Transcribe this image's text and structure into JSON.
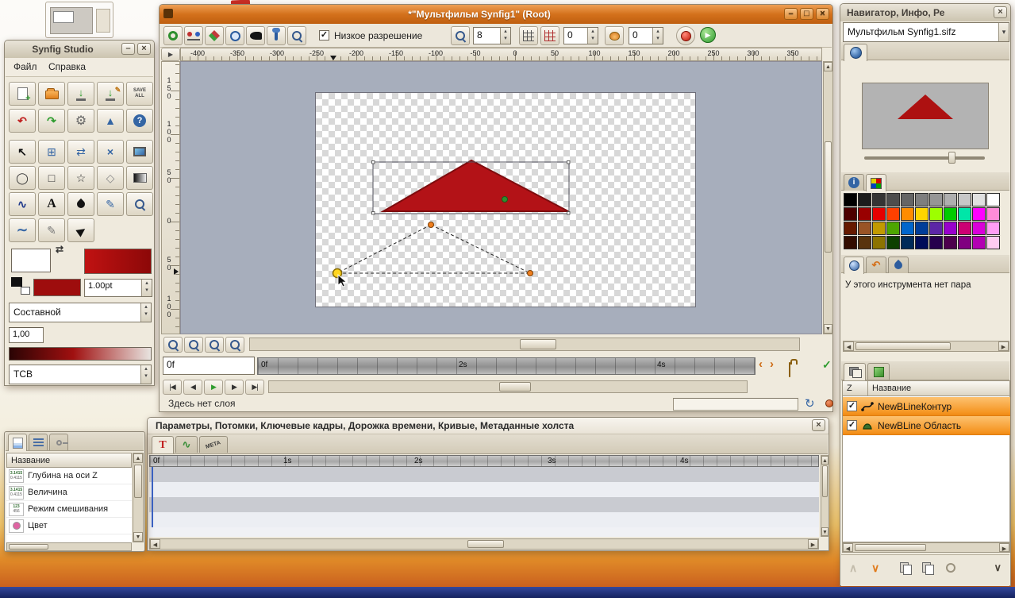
{
  "icons": {
    "minimize": "–",
    "maximize": "□",
    "close": "×",
    "swap": "⇄",
    "new_plus": "+",
    "save_arrow": "↓",
    "undo": "↶",
    "redo": "↷",
    "gear": "⚙",
    "about": "▲",
    "help": "?",
    "transform": "↖",
    "smooth_move": "⊞",
    "mirror": "⇄",
    "scale": "×",
    "circle": "◯",
    "rectangle": "□",
    "star": "☆",
    "polygon": "◇",
    "spline": "∿",
    "text": "A",
    "draw": "✎",
    "pencil": "✎",
    "sketch": "∼",
    "bird": "▶",
    "param_tab": "T",
    "spin_up": "▴",
    "spin_down": "▾",
    "check": "✓",
    "arrow_up": "▲",
    "arrow_down": "▼",
    "arrow_left": "◀",
    "arrow_right": "▶",
    "nav_prev": "‹",
    "nav_next": "›",
    "seek_begin": "|◀",
    "frame_prev": "◀",
    "play": "▶",
    "frame_next": "▶",
    "seek_end": "▶|",
    "refresh": "↻",
    "ruler_toggle": "▶",
    "info": "i",
    "chev_up": "∧",
    "chev_down": "∨"
  },
  "toolbox": {
    "title": "Synfig Studio",
    "menu": {
      "file": "Файл",
      "help": "Справка"
    },
    "save_all_label": "SAVE ALL",
    "brush_size": "1.00pt",
    "blend_method": "Составной",
    "opacity": "1,00",
    "color_model": "ТСВ"
  },
  "canvas": {
    "title": "*\"Мультфильм Synfig1\" (Root)",
    "toolbar": {
      "low_res_label": "Низкое разрешение",
      "quality": "8",
      "past_onion": "0",
      "future_onion": "0"
    },
    "ruler_h": [
      "-400",
      "-350",
      "-300",
      "-250",
      "-200",
      "-150",
      "-100",
      "-50",
      "0",
      "50",
      "100",
      "150",
      "200",
      "250",
      "300",
      "350"
    ],
    "ruler_v": [
      "150",
      "100",
      "50",
      "0",
      "50",
      "100"
    ],
    "time_field": "0f",
    "timebar": [
      "0f",
      "2s",
      "4s"
    ],
    "status": "Здесь нет слоя"
  },
  "params_window": {
    "title": "Параметры, Потомки, Ключевые кадры, Дорожка времени, Кривые, Метаданные холста",
    "meta_tab": "META",
    "time_ruler": [
      "0f",
      "1s",
      "2s",
      "3s",
      "4s"
    ]
  },
  "params_panel": {
    "name_header": "Название",
    "rows": [
      {
        "icon_top": "3.1415",
        "icon_bottom": "0.4115",
        "label": "Глубина на оси Z"
      },
      {
        "icon_top": "3.1415",
        "icon_bottom": "0.4115",
        "label": "Величина"
      },
      {
        "icon_top": "123",
        "icon_bottom": "456",
        "label": "Режим смешивания"
      },
      {
        "icon_top": "",
        "icon_bottom": "",
        "label": "Цвет",
        "color": "#df64a2"
      }
    ]
  },
  "navigator": {
    "title": "Навигатор, Инфо, Ре",
    "file_name": "Мультфильм Synfig1.sifz",
    "no_params_text": "У этого инструмента нет пара",
    "layers_header": {
      "z": "Z",
      "name": "Название"
    },
    "layers": [
      {
        "checked": true,
        "label": "NewBLineКонтур"
      },
      {
        "checked": true,
        "label": "NewBLine Область"
      }
    ],
    "palette": [
      "#000000",
      "#1c1c1c",
      "#343434",
      "#4d4d4d",
      "#656565",
      "#7e7e7e",
      "#969696",
      "#afafaf",
      "#c7c7c7",
      "#e0e0e0",
      "#ffffff",
      "#4d0000",
      "#990000",
      "#e60000",
      "#ff4000",
      "#ff8c00",
      "#ffd500",
      "#9dff00",
      "#00cc00",
      "#00e6a8",
      "#ff00ff",
      "#ff8cd9",
      "#661a00",
      "#995426",
      "#c29a00",
      "#4da600",
      "#0066cc",
      "#003d99",
      "#5c26a6",
      "#9900cc",
      "#cc0073",
      "#d900d9",
      "#ff9ef5",
      "#330d00",
      "#59330d",
      "#8c7300",
      "#0d4000",
      "#002b59",
      "#000d59",
      "#26004d",
      "#4d004d",
      "#800080",
      "#b300b3",
      "#ffccf2"
    ]
  }
}
